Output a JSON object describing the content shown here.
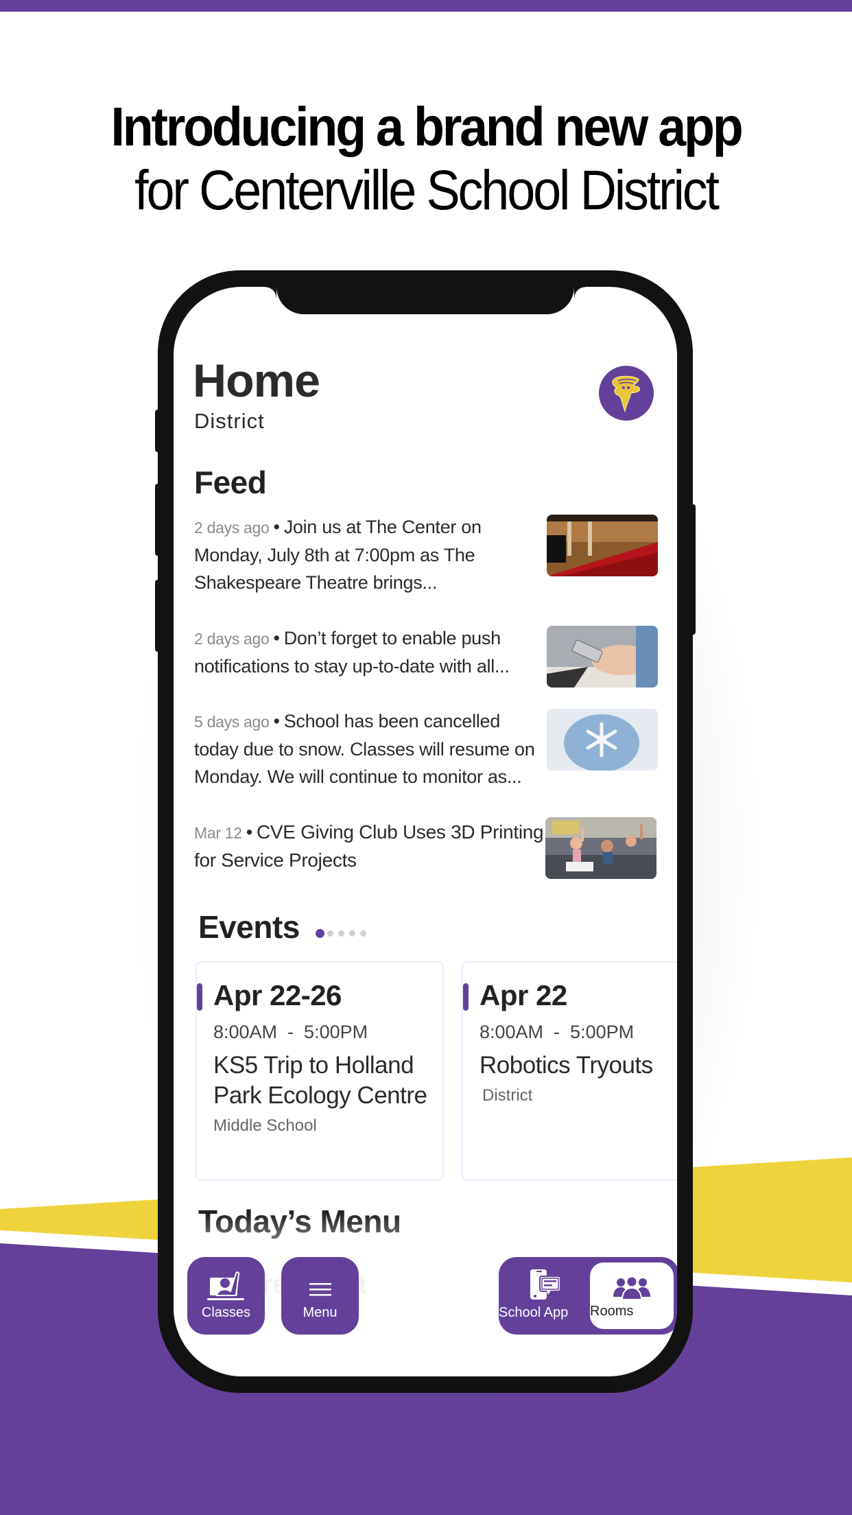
{
  "promo": {
    "headline_bold": "Introducing a brand new app",
    "headline_regular": "for Centerville School District"
  },
  "colors": {
    "brand_purple": "#63419a",
    "brand_yellow": "#efd33c",
    "text_dark": "#222222",
    "text_muted": "#8a8a8a"
  },
  "app": {
    "page_title": "Home",
    "page_subtitle": "District",
    "logo_icon": "tornado-mascot-icon",
    "feed": {
      "title": "Feed",
      "items": [
        {
          "time": "2 days ago",
          "text": "Join us at The Center on Monday, July 8th at 7:00pm as The Shakespeare Theatre brings...",
          "image": "theater-seats-photo"
        },
        {
          "time": "2 days ago",
          "text": "Don’t forget to enable push notifications to stay up-to-date with all...",
          "image": "phone-hands-photo"
        },
        {
          "time": "5 days ago",
          "text": "School has been cancelled today due to snow. Classes will resume on Monday. We will continue to monitor as...",
          "image": "mittens-snowflake-photo"
        },
        {
          "time": "Mar 12",
          "text": "CVE Giving Club Uses 3D Printing for Service Projects",
          "image": "classroom-photo"
        }
      ]
    },
    "events": {
      "title": "Events",
      "page_count": 5,
      "active_page": 1,
      "items": [
        {
          "date": "Apr 22-26",
          "time": "8:00AM  -  5:00PM",
          "name": "KS5 Trip to Holland Park Ecology Centre",
          "audience": "Middle School"
        },
        {
          "date": "Apr 22",
          "time": "8:00AM  -  5:00PM",
          "name": "Robotics Tryouts",
          "audience": "District"
        }
      ]
    },
    "menu": {
      "title": "Today’s Menu",
      "faded_subtitle": "Breakfast"
    },
    "bottom_nav": {
      "classes": {
        "label": "Classes",
        "icon": "raised-hand-classroom-icon"
      },
      "menu": {
        "label": "Menu",
        "icon": "hamburger-menu-icon"
      },
      "school_app": {
        "label": "School App",
        "icon": "phone-message-icon"
      },
      "rooms": {
        "label": "Rooms",
        "icon": "people-group-icon",
        "active": true
      }
    }
  }
}
